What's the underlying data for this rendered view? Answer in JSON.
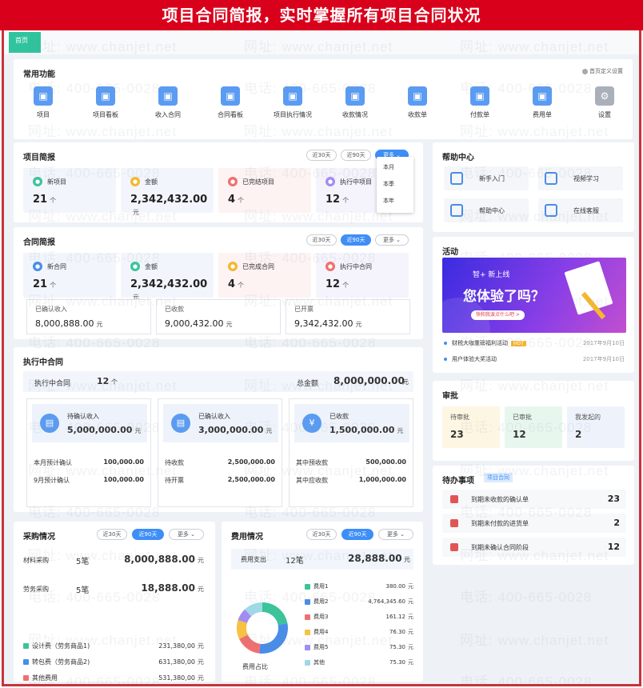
{
  "banner": "项目合同简报，实时掌握所有项目合同状况",
  "tab": "首页",
  "watermarks": {
    "site": "网址: www.chanjet.net",
    "phone": "电话: 400-665-0028"
  },
  "quick": {
    "title": "常用功能",
    "custom": "首页定义设置",
    "items": [
      {
        "label": "项目",
        "icon": "project-icon"
      },
      {
        "label": "项目看板",
        "icon": "project-board-icon"
      },
      {
        "label": "收入合同",
        "icon": "income-contract-icon"
      },
      {
        "label": "合同看板",
        "icon": "contract-board-icon"
      },
      {
        "label": "项目执行情况",
        "icon": "project-execution-icon"
      },
      {
        "label": "收款情况",
        "icon": "collection-status-icon"
      },
      {
        "label": "收款单",
        "icon": "receipt-icon"
      },
      {
        "label": "付款单",
        "icon": "payment-icon"
      },
      {
        "label": "费用单",
        "icon": "expense-icon"
      },
      {
        "label": "设置",
        "icon": "settings-icon"
      }
    ]
  },
  "project_brief": {
    "title": "项目简报",
    "toggles": [
      "近30天",
      "近90天",
      "更多"
    ],
    "dropdown": [
      "本月",
      "本季",
      "本年"
    ],
    "stats": [
      {
        "label": "新项目",
        "value": "21",
        "unit": "个"
      },
      {
        "label": "金额",
        "value": "2,342,432.00",
        "unit": "元"
      },
      {
        "label": "已完结项目",
        "value": "4",
        "unit": "个"
      },
      {
        "label": "执行中项目",
        "value": "12",
        "unit": "个"
      }
    ]
  },
  "contract_brief": {
    "title": "合同简报",
    "toggles": [
      "近30天",
      "近90天",
      "更多"
    ],
    "stats": [
      {
        "label": "新合同",
        "value": "21",
        "unit": "个"
      },
      {
        "label": "金额",
        "value": "2,342,432.00",
        "unit": "元"
      },
      {
        "label": "已完成合同",
        "value": "4",
        "unit": "个"
      },
      {
        "label": "执行中合同",
        "value": "12",
        "unit": "个"
      }
    ],
    "subs": [
      {
        "label": "已确认收入",
        "value": "8,000,888.00",
        "unit": "元"
      },
      {
        "label": "已收款",
        "value": "9,000,432.00",
        "unit": "元"
      },
      {
        "label": "已开票",
        "value": "9,342,432.00",
        "unit": "元"
      }
    ]
  },
  "executing": {
    "title": "执行中合同",
    "count_label": "执行中合同",
    "count": "12",
    "count_unit": "个",
    "total_label": "总金额",
    "total": "8,000,000.00",
    "total_unit": "元",
    "boxes": [
      {
        "label": "待确认收入",
        "value": "5,000,000.00",
        "unit": "元",
        "icon": "document-icon",
        "rows": [
          {
            "label": "本月预计确认",
            "value": "100,000.00"
          },
          {
            "label": "9月预计确认",
            "value": "100,000.00"
          }
        ]
      },
      {
        "label": "已确认收入",
        "value": "3,000,000.00",
        "unit": "元",
        "icon": "confirmed-icon",
        "rows": [
          {
            "label": "待收款",
            "value": "2,500,000.00"
          },
          {
            "label": "待开票",
            "value": "2,500,000.00"
          }
        ]
      },
      {
        "label": "已收款",
        "value": "1,500,000.00",
        "unit": "元",
        "icon": "yuan-icon",
        "rows": [
          {
            "label": "其中预收款",
            "value": "500,000.00"
          },
          {
            "label": "其中应收款",
            "value": "1,000,000.00"
          }
        ]
      }
    ]
  },
  "purchase": {
    "title": "采购情况",
    "toggles": [
      "近30天",
      "近90天",
      "更多"
    ],
    "rows": [
      {
        "label": "材料采购",
        "count": "5笔",
        "amount": "8,000,888.00",
        "unit": "元"
      },
      {
        "label": "劳务采购",
        "count": "5笔",
        "amount": "18,888.00",
        "unit": "元"
      }
    ],
    "legend": [
      {
        "label": "设计费（劳务商品1)",
        "value": "231,380,00",
        "unit": "元",
        "color": "#3cc39a"
      },
      {
        "label": "转包费（劳务商品2)",
        "value": "631,380,00",
        "unit": "元",
        "color": "#4a8de6"
      },
      {
        "label": "其他费用",
        "value": "531,380,00",
        "unit": "元",
        "color": "#f07070"
      }
    ]
  },
  "expense": {
    "title": "费用情况",
    "toggles": [
      "近30天",
      "近90天",
      "更多"
    ],
    "sum_label": "费用支出",
    "sum_count": "12笔",
    "sum_amount": "28,888.00",
    "sum_unit": "元",
    "donut_label": "费用占比",
    "items": [
      {
        "label": "费用1",
        "value": "380.00",
        "amount": 380.0,
        "color": "#3cc39a"
      },
      {
        "label": "费用2",
        "value": "4,764,345.60",
        "amount": 4764345.6,
        "color": "#4a8de6"
      },
      {
        "label": "费用3",
        "value": "161.12",
        "amount": 161.12,
        "color": "#f07070"
      },
      {
        "label": "费用4",
        "value": "76.30",
        "amount": 76.3,
        "color": "#f5c242"
      },
      {
        "label": "费用5",
        "value": "75.30",
        "amount": 75.3,
        "color": "#a38cf0"
      },
      {
        "label": "其他",
        "value": "75.30",
        "amount": 75.3,
        "color": "#9fd9e6"
      }
    ],
    "unit": "元"
  },
  "help": {
    "title": "帮助中心",
    "items": [
      {
        "label": "新手入门",
        "icon": "checklist-icon"
      },
      {
        "label": "视频学习",
        "icon": "video-icon"
      },
      {
        "label": "帮助中心",
        "icon": "doc-help-icon"
      },
      {
        "label": "在线客服",
        "icon": "customer-service-icon"
      }
    ]
  },
  "activity": {
    "title": "活动",
    "banner_top": "智+ 新上线",
    "banner_main": "您体验了吗？",
    "banner_btn": "快和我波点什么吧 >",
    "items": [
      {
        "label": "财税大咖重磅福利活动",
        "badge": "HOT",
        "date": "2017年9月10日"
      },
      {
        "label": "用户体验大奖活动",
        "badge": "",
        "date": "2017年9月10日"
      }
    ]
  },
  "approval": {
    "title": "审批",
    "items": [
      {
        "label": "待审批",
        "value": "23",
        "color": "#fdf6e3"
      },
      {
        "label": "已审批",
        "value": "12",
        "color": "#e8f7ee"
      },
      {
        "label": "我发起的",
        "value": "2",
        "color": "#eef3fb"
      }
    ]
  },
  "todo": {
    "title": "待办事项",
    "tag": "项目合同",
    "items": [
      {
        "label": "到期未收款的确认单",
        "value": "23"
      },
      {
        "label": "到期未付款的进货单",
        "value": "2"
      },
      {
        "label": "到期未确认合同阶段",
        "value": "12"
      }
    ]
  }
}
